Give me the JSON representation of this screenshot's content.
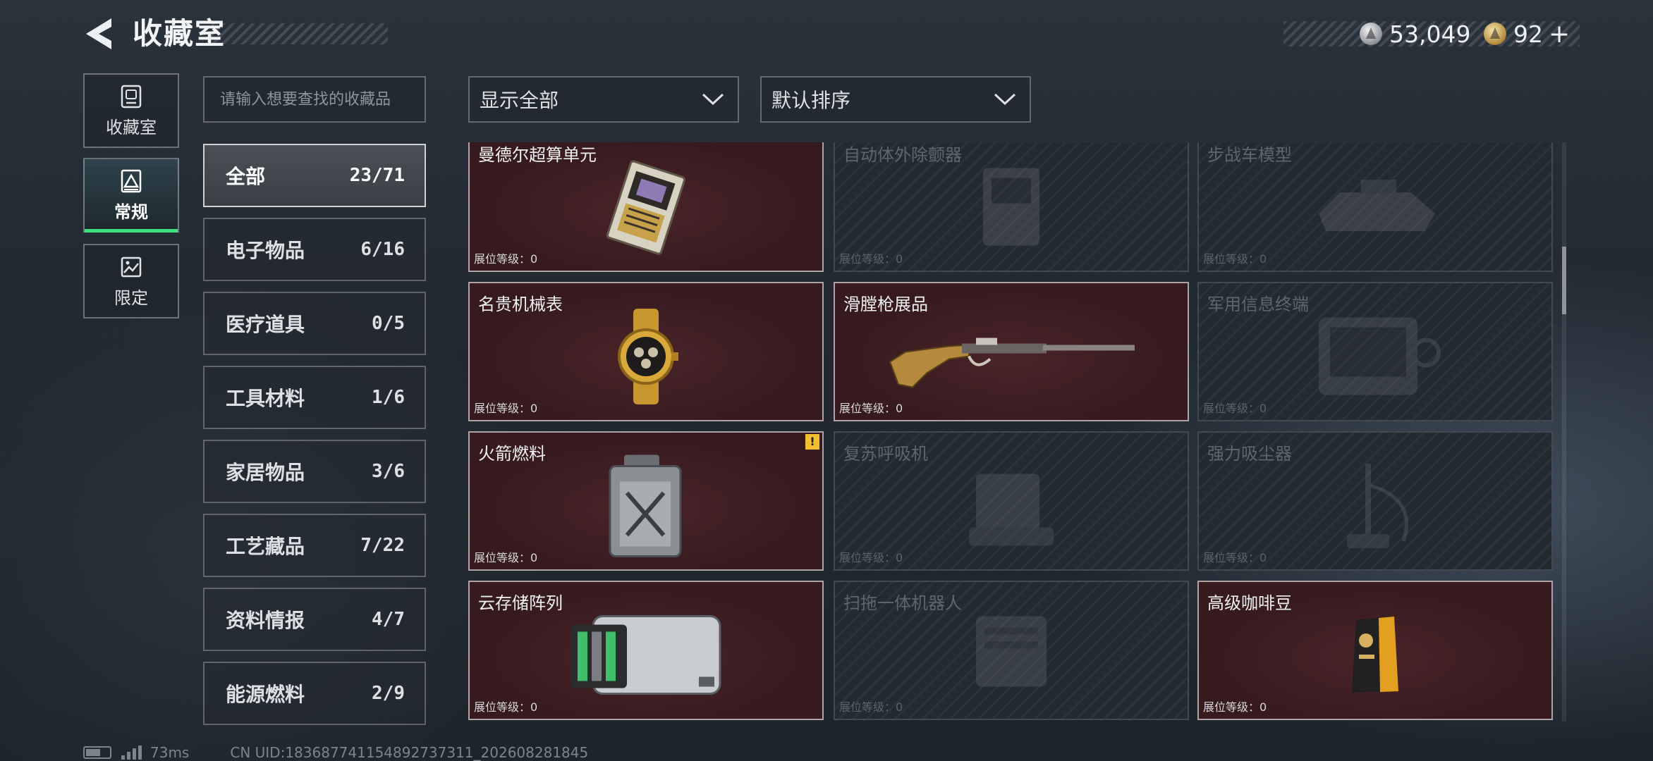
{
  "header": {
    "title": "收藏室",
    "currency_silver": "53,049",
    "currency_gold": "92",
    "plus_label": "+"
  },
  "side_tabs": [
    {
      "label": "收藏室",
      "icon": "collection-room-icon"
    },
    {
      "label": "常规",
      "icon": "regular-exhibit-icon",
      "active": true
    },
    {
      "label": "限定",
      "icon": "limited-exhibit-icon"
    }
  ],
  "search": {
    "placeholder": "请输入想要查找的收藏品"
  },
  "filters": {
    "display": "显示全部",
    "sort": "默认排序"
  },
  "categories": [
    {
      "label": "全部",
      "count": "23/71",
      "active": true
    },
    {
      "label": "电子物品",
      "count": "6/16"
    },
    {
      "label": "医疗道具",
      "count": "0/5"
    },
    {
      "label": "工具材料",
      "count": "1/6"
    },
    {
      "label": "家居物品",
      "count": "3/6"
    },
    {
      "label": "工艺藏品",
      "count": "7/22"
    },
    {
      "label": "资料情报",
      "count": "4/7"
    },
    {
      "label": "能源燃料",
      "count": "2/9"
    }
  ],
  "cards": [
    {
      "name": "曼德尔超算单元",
      "level": "展位等级：0",
      "owned": true
    },
    {
      "name": "自动体外除颤器",
      "level": "展位等级：0",
      "owned": false
    },
    {
      "name": "步战车模型",
      "level": "展位等级：0",
      "owned": false
    },
    {
      "name": "名贵机械表",
      "level": "展位等级：0",
      "owned": true
    },
    {
      "name": "滑膛枪展品",
      "level": "展位等级：0",
      "owned": true
    },
    {
      "name": "军用信息终端",
      "level": "展位等级：0",
      "owned": false
    },
    {
      "name": "火箭燃料",
      "level": "展位等级：0",
      "owned": true,
      "badge": "!"
    },
    {
      "name": "复苏呼吸机",
      "level": "展位等级：0",
      "owned": false
    },
    {
      "name": "强力吸尘器",
      "level": "展位等级：0",
      "owned": false
    },
    {
      "name": "云存储阵列",
      "level": "展位等级：0",
      "owned": true
    },
    {
      "name": "扫拖一体机器人",
      "level": "展位等级：0",
      "owned": false
    },
    {
      "name": "高级咖啡豆",
      "level": "展位等级：0",
      "owned": true
    }
  ],
  "footer": {
    "ping": "73ms",
    "uid": "CN UID:1836877411548927373​11_202608281845"
  }
}
